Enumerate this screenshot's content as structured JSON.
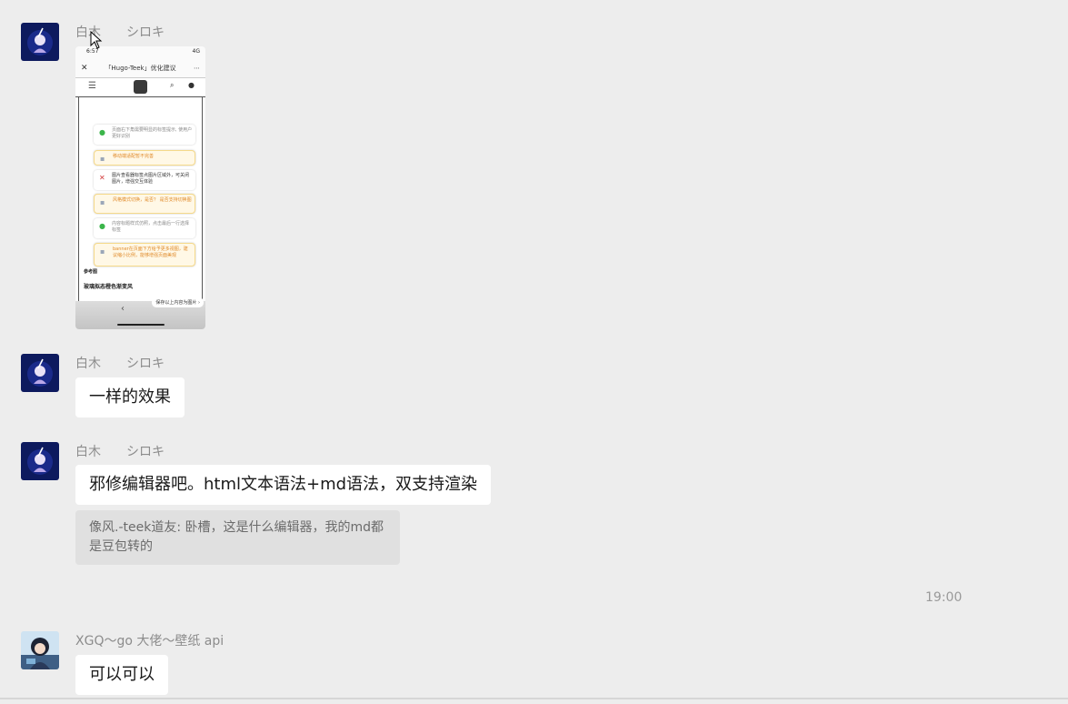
{
  "messages": [
    {
      "sender_name": "白木",
      "sender_alias": "シロキ",
      "image": {
        "status_time": "6:57",
        "status_right": "4G",
        "page_title": "「Hugo-Teek」优化建议",
        "cards": [
          {
            "kind": "check",
            "text": "页面右下角需要明显的标签提示, 使用户更好识别"
          },
          {
            "kind": "warn",
            "text": "移动端适配暂不完善"
          },
          {
            "kind": "cross",
            "text": "图片查看器标签点图片区域外，可关闭图片，增强交互体验"
          },
          {
            "kind": "warn",
            "text": "风格模式切换，是否？ 是否支持切换图"
          },
          {
            "kind": "check",
            "text": "内容标题样式仿照，点击最后一行选择标签"
          },
          {
            "kind": "warn",
            "text": "banner在页面下方给予更多视图，建议缩小比例，能够增强页面美观"
          }
        ],
        "footer_label": "参考图",
        "footer_title": "玻璃拟态橙色渐变风",
        "save_button": "保存以上内容为图片 ›"
      }
    },
    {
      "sender_name": "白木",
      "sender_alias": "シロキ",
      "text": "一样的效果"
    },
    {
      "sender_name": "白木",
      "sender_alias": "シロキ",
      "text": "邪修编辑器吧。html文本语法+md语法，双支持渲染",
      "quote": "像风.-teek道友: 卧槽，这是什么编辑器，我的md都是豆包转的"
    },
    {
      "sender_name": "XGQ～go 大佬～壁纸 api",
      "text": "可以可以"
    }
  ],
  "timestamp": "19:00",
  "colors": {
    "background": "#ededed",
    "bubble": "#ffffff",
    "quote_bg": "#e0e0e0"
  },
  "icons": [
    "avatar-shiroki",
    "avatar-xgq",
    "mouse-cursor-icon"
  ]
}
